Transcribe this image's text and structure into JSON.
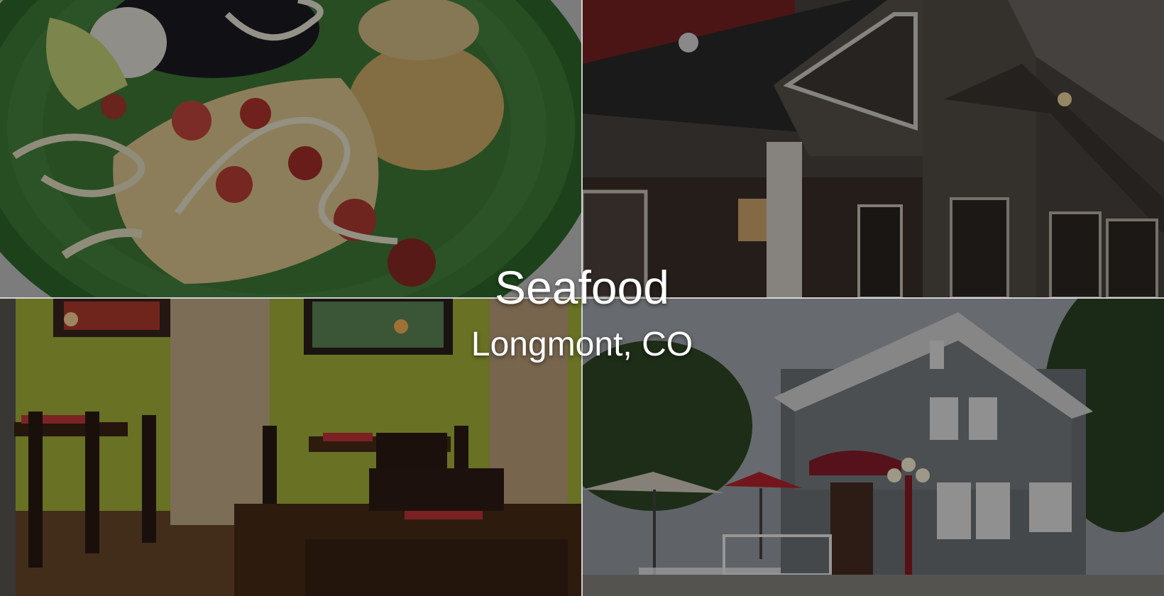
{
  "hero": {
    "title": "Seafood",
    "subtitle": "Longmont, CO"
  },
  "photos": [
    {
      "name": "plated-seafood-dish",
      "subject": "fish with pico de gallo, black beans, rice and lime on green plate"
    },
    {
      "name": "restaurant-exterior-facade",
      "subject": "stone and wood restaurant storefront at dusk"
    },
    {
      "name": "dining-room-interior",
      "subject": "green walls, stone pillars, wooden tables with red napkins"
    },
    {
      "name": "restaurant-house-exterior",
      "subject": "gray two-story house with red awning, umbrellas and patio"
    }
  ],
  "colors": {
    "overlay": "#000000",
    "text": "#ffffff",
    "plate": "#3f7a3a",
    "wall_green": "#8c9b2e",
    "awning_red": "#8a1e2b"
  }
}
